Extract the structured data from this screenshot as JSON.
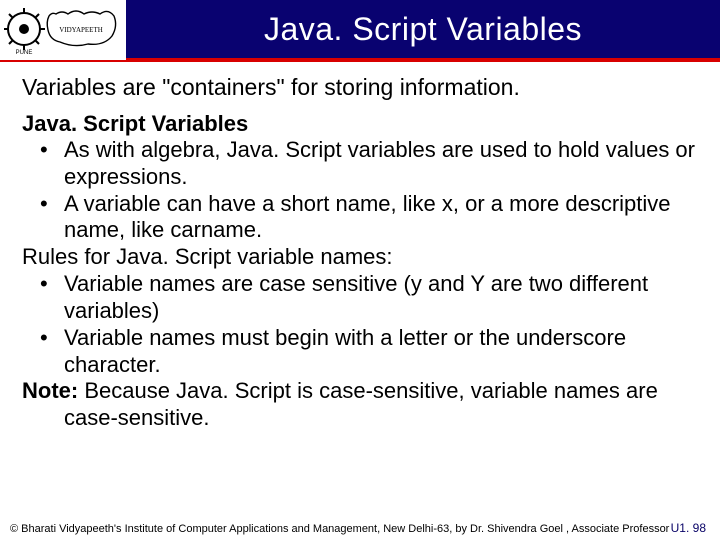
{
  "header": {
    "title": "Java. Script Variables"
  },
  "content": {
    "intro": "Variables are \"containers\" for storing information.",
    "subhead": "Java. Script Variables",
    "bullets1": [
      "As with algebra, Java. Script variables are used to hold values or expressions.",
      "A variable can have a short name, like x, or a more descriptive name, like carname."
    ],
    "rules_heading": "Rules for Java. Script variable names:",
    "bullets2": [
      "Variable names are case sensitive (y and Y are two different variables)",
      "Variable names must begin with a letter or the underscore character."
    ],
    "note_label": "Note:",
    "note_text": " Because Java. Script is case-sensitive, variable names are case-sensitive."
  },
  "footer": {
    "credit": "© Bharati Vidyapeeth's Institute of Computer Applications and Management, New Delhi-63, by Dr. Shivendra Goel , Associate Professor",
    "page": "U1. 98"
  }
}
